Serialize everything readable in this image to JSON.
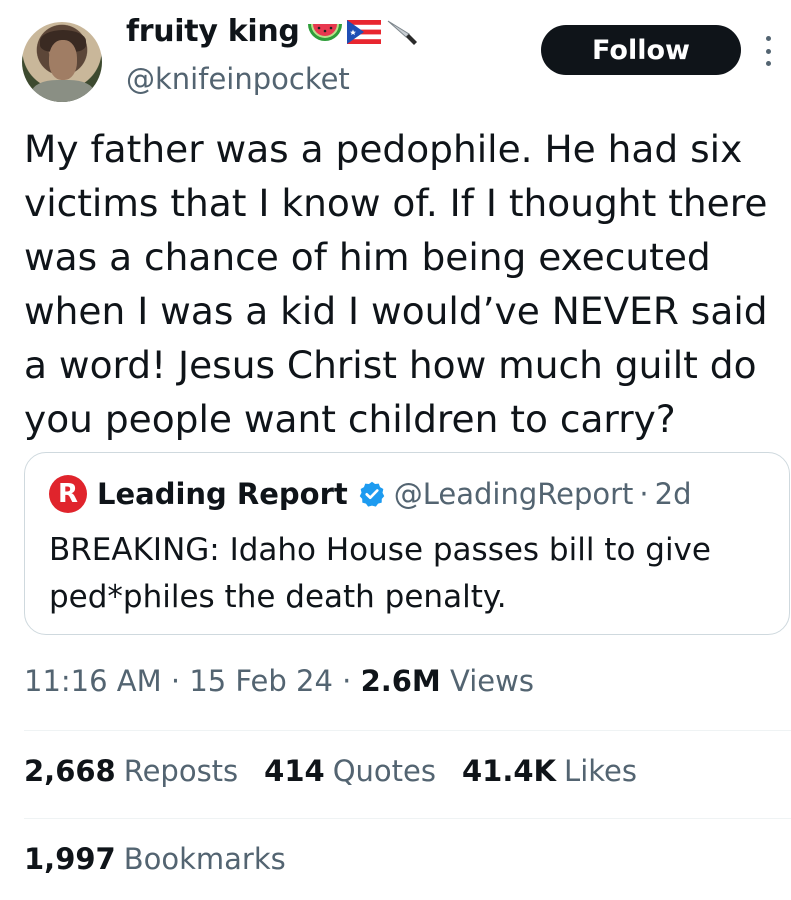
{
  "author": {
    "display_name": "fruity king",
    "handle": "@knifeinpocket",
    "emoji": [
      "watermelon-icon",
      "puerto-rico-flag-icon",
      "knife-icon"
    ]
  },
  "follow_label": "Follow",
  "tweet": {
    "text": "My father was a pedophile. He had six\nvictims that I know of. If I thought there\nwas a chance of him being executed\nwhen I was a kid I would’ve NEVER said\na word! Jesus Christ how much guilt do\nyou people want children to carry?"
  },
  "quoted_tweet": {
    "name": "Leading Report",
    "handle": "@LeadingReport",
    "separator": "·",
    "time": "2d",
    "text": "BREAKING: Idaho House passes bill to give\nped*philes the death penalty.",
    "logo_letter": "R"
  },
  "meta": {
    "time": "11:16 AM",
    "date": "15 Feb 24",
    "views_count": "2.6M",
    "views_label": "Views",
    "separator": "·"
  },
  "stats": [
    {
      "count": "2,668",
      "label": "Reposts"
    },
    {
      "count": "414",
      "label": "Quotes"
    },
    {
      "count": "41.4K",
      "label": "Likes"
    }
  ],
  "bookmarks": {
    "count": "1,997",
    "label": "Bookmarks"
  },
  "colors": {
    "text": "#0f1419",
    "secondary": "#536471",
    "border": "#cfd9de",
    "verified": "#1d9bf0",
    "leading_report_red": "#e0242c"
  }
}
